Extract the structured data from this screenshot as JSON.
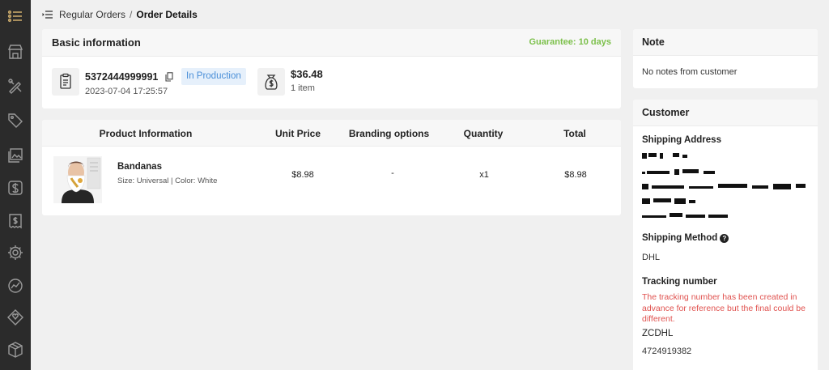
{
  "sidebar": {
    "icons": [
      "list-icon",
      "store-icon",
      "design-tools-icon",
      "tag-icon",
      "images-icon",
      "dollar-sign-icon",
      "invoice-icon",
      "settings-gear-icon",
      "analytics-icon",
      "branding-icon",
      "package-icon"
    ]
  },
  "breadcrumb": {
    "parent": "Regular Orders",
    "separator": "/",
    "current": "Order Details"
  },
  "basic": {
    "title": "Basic information",
    "guarantee": "Guarantee: 10 days",
    "order_number": "5372444999991",
    "status": "In Production",
    "date": "2023-07-04 17:25:57",
    "amount": "$36.48",
    "items": "1 item"
  },
  "product_table": {
    "headers": {
      "product": "Product Information",
      "unit_price": "Unit Price",
      "branding": "Branding options",
      "quantity": "Quantity",
      "total": "Total"
    },
    "rows": [
      {
        "name": "Bandanas",
        "variant": "Size: Universal | Color: White",
        "unit_price": "$8.98",
        "branding": "-",
        "quantity": "x1",
        "total": "$8.98"
      }
    ]
  },
  "note": {
    "title": "Note",
    "text": "No notes from customer"
  },
  "customer": {
    "title": "Customer",
    "shipping_address_label": "Shipping Address",
    "shipping_method_label": "Shipping Method",
    "shipping_method": "DHL",
    "tracking_label": "Tracking number",
    "tracking_warning": "The tracking number has been created in advance for reference but the final could be different.",
    "carrier_code": "ZCDHL",
    "tracking_number": "4724919382"
  },
  "colors": {
    "sidebar_bg": "#2b2b2b",
    "guarantee": "#7cc04b",
    "status_text": "#4a8fd8",
    "status_bg": "#e6f0fb",
    "warning": "#e0524f"
  }
}
